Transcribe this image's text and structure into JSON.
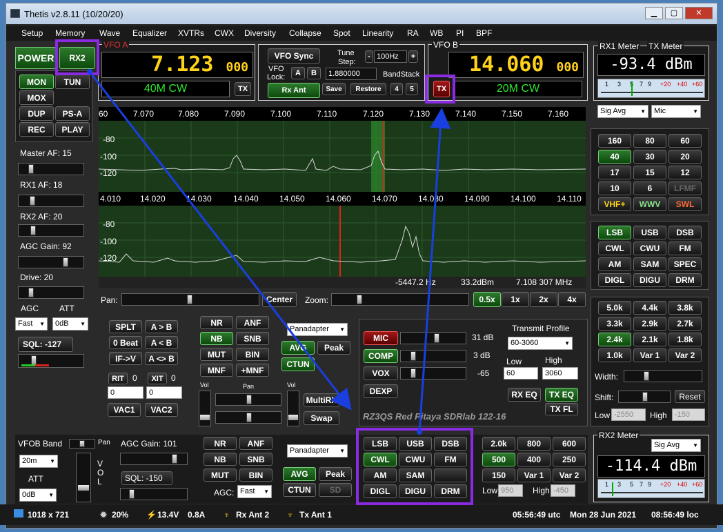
{
  "window": {
    "title": "Thetis v2.8.11 (10/20/20)",
    "min": "▁",
    "max": "▢",
    "close": "✕"
  },
  "menu": [
    "Setup",
    "Memory",
    "Wave",
    "Equalizer",
    "XVTRs",
    "CWX",
    "Diversity",
    "Collapse",
    "Spot",
    "Linearity",
    "RA",
    "WB",
    "PI",
    "BPF"
  ],
  "left": {
    "power": "POWER",
    "rx2": "RX2",
    "mon": "MON",
    "tun": "TUN",
    "mox": "MOX",
    "dup": "DUP",
    "psa": "PS-A",
    "rec": "REC",
    "play": "PLAY",
    "master_af": "Master AF:  15",
    "rx1_af": "RX1 AF:  18",
    "rx2_af": "RX2 AF:  20",
    "agc_gain": "AGC Gain:  92",
    "drive": "Drive:  20",
    "agc": "AGC",
    "att": "ATT",
    "agc_val": "Fast",
    "att_val": "0dB",
    "sql": "SQL:  -127"
  },
  "vfoa": {
    "label": "VFO A",
    "freq": "7.123",
    "freq_small": "000",
    "mode": "40M CW",
    "tx": "TX"
  },
  "vfob": {
    "label": "VFO B",
    "freq": "14.060",
    "freq_small": "000",
    "mode": "20M CW",
    "tx": "TX"
  },
  "vfoctl": {
    "sync": "VFO Sync",
    "tune": "Tune",
    "step": "Step:",
    "step_val": "100Hz",
    "minus": "-",
    "plus": "+",
    "vfo": "VFO",
    "lock": "Lock:",
    "a": "A",
    "b": "B",
    "freq": "1.880000",
    "bandstack": "BandStack",
    "rxant": "Rx Ant",
    "save": "Save",
    "restore": "Restore",
    "b4": "4",
    "b5": "5"
  },
  "meters": {
    "rx1": "RX1 Meter",
    "tx": "TX Meter",
    "rx1_val": "-93.4 dBm",
    "rx2": "RX2 Meter",
    "rx2_val": "-114.4 dBm",
    "sig_avg": "Sig Avg",
    "mic": "Mic",
    "scale": [
      "1",
      "3",
      "5",
      "7",
      "9",
      "+20",
      "+40",
      "+60"
    ]
  },
  "pan1": {
    "ticks": [
      "7.070",
      "7.080",
      "7.090",
      "7.100",
      "7.110",
      "7.120",
      "7.130",
      "7.140",
      "7.150",
      "7.160"
    ],
    "db": [
      "-80",
      "-100",
      "-120"
    ],
    "left": "60"
  },
  "pan2": {
    "ticks": [
      "4.010",
      "14.020",
      "14.030",
      "14.040",
      "14.050",
      "14.060",
      "14.070",
      "14.080",
      "14.090",
      "14.100",
      "14.110"
    ],
    "db": [
      "-80",
      "-100",
      "-120"
    ],
    "readout1": "-5447.2 Hz",
    "readout2": "33.2dBm",
    "readout3": "7.108 307 MHz"
  },
  "panzoom": {
    "pan": "Pan:",
    "center": "Center",
    "zoom": "Zoom:",
    "z05": "0.5x",
    "z1": "1x",
    "z2": "2x",
    "z4": "4x"
  },
  "bands": [
    "160",
    "80",
    "60",
    "40",
    "30",
    "20",
    "17",
    "15",
    "12",
    "10",
    "6",
    "LFMF",
    "VHF+",
    "WWV",
    "SWL"
  ],
  "modes": [
    "LSB",
    "USB",
    "DSB",
    "CWL",
    "CWU",
    "FM",
    "AM",
    "SAM",
    "SPEC",
    "DIGL",
    "DIGU",
    "DRM"
  ],
  "filters": [
    "5.0k",
    "4.4k",
    "3.8k",
    "3.3k",
    "2.9k",
    "2.7k",
    "2.4k",
    "2.1k",
    "1.8k",
    "1.0k",
    "Var 1",
    "Var 2"
  ],
  "filterctl": {
    "width": "Width:",
    "shift": "Shift:",
    "reset": "Reset",
    "low": "Low",
    "high": "High",
    "low_val": "-2550",
    "high_val": "-150"
  },
  "rx1ctl": {
    "split": "SPLT",
    "atob": "A > B",
    "zerobeat": "0 Beat",
    "altb": "A < B",
    "ifv": "IF->V",
    "aswap": "A <> B",
    "rit": "RIT",
    "rit_v": "0",
    "xit": "XIT",
    "xit_v": "0",
    "rit_num": "0",
    "xit_num": "0",
    "vac1": "VAC1",
    "vac2": "VAC2",
    "nr": "NR",
    "anf": "ANF",
    "nb": "NB",
    "snb": "SNB",
    "mut": "MUT",
    "bin": "BIN",
    "mnf": "MNF",
    "pmnf": "+MNF",
    "display": "Panadapter",
    "avg": "AVG",
    "peak": "Peak",
    "ctun": "CTUN",
    "multi": "MultiRX",
    "swap": "Swap",
    "vol": "Vol",
    "pan": "Pan"
  },
  "tx": {
    "mic": "MIC",
    "mic_v": "31 dB",
    "comp": "COMP",
    "comp_v": "3 dB",
    "vox": "VOX",
    "vox_v": "-65",
    "dexp": "DEXP",
    "profile_l": "Transmit Profile",
    "profile": "60-3060",
    "low": "Low",
    "high": "High",
    "low_v": "60",
    "high_v": "3060",
    "rxeq": "RX EQ",
    "txeq": "TX EQ",
    "txfl": "TX FL",
    "brand": "RZ3QS  Red Pitaya SDRlab 122-16"
  },
  "rx2panel": {
    "vfob_band": "VFOB Band",
    "band": "20m",
    "att": "ATT",
    "att_v": "0dB",
    "pan": "Pan",
    "vol": "VOL",
    "agc_gain": "AGC Gain:  101",
    "sql": "SQL:  -150",
    "nr": "NR",
    "anf": "ANF",
    "nb": "NB",
    "snb": "SNB",
    "mut": "MUT",
    "bin": "BIN",
    "display": "Panadapter",
    "avg": "AVG",
    "peak": "Peak",
    "ctun": "CTUN",
    "sd": "SD",
    "agc": "AGC:",
    "agc_v": "Fast",
    "modes": [
      "LSB",
      "USB",
      "DSB",
      "CWL",
      "CWU",
      "FM",
      "AM",
      "SAM",
      "",
      "DIGL",
      "DIGU",
      "DRM"
    ],
    "filters": [
      "2.0k",
      "800",
      "600",
      "500",
      "400",
      "250",
      "150",
      "Var 1",
      "Var 2"
    ],
    "low": "Low",
    "high": "High",
    "low_v": "950",
    "high_v": "-450"
  },
  "status": {
    "res": "1018 x 721",
    "cpu": "20%",
    "volt": "13.4V",
    "amp": "0.8A",
    "rxant": "Rx Ant 2",
    "txant": "Tx Ant 1",
    "utc": "05:56:49 utc",
    "date": "Mon 28 Jun 2021",
    "loc": "08:56:49 loc"
  },
  "colors": {
    "accent_green": "#2d7a2d",
    "freq_yellow": "#ffd21a",
    "highlight": "#8a2be2",
    "arrow": "#1a3fe0"
  }
}
